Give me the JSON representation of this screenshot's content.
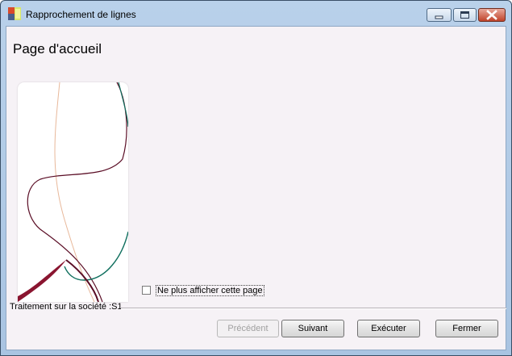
{
  "window": {
    "title": "Rapprochement de lignes"
  },
  "page": {
    "heading": "Page d'accueil"
  },
  "checkbox": {
    "label": "Ne plus afficher cette page",
    "checked": false
  },
  "status": {
    "company_label": "Traitement sur la société :S1"
  },
  "buttons": {
    "previous": "Précédent",
    "next": "Suivant",
    "execute": "Exécuter",
    "close": "Fermer"
  },
  "icons": {
    "app": "app-icon",
    "minimize": "minimize-icon",
    "maximize": "maximize-icon",
    "close": "close-icon"
  },
  "colors": {
    "titlebar": "#b9d1ea",
    "client_bg": "#f6f2f6",
    "close_button": "#c0432a",
    "curve_dark": "#5a0d25",
    "curve_teal": "#0f6f5e",
    "curve_peach": "#e8b89a"
  }
}
